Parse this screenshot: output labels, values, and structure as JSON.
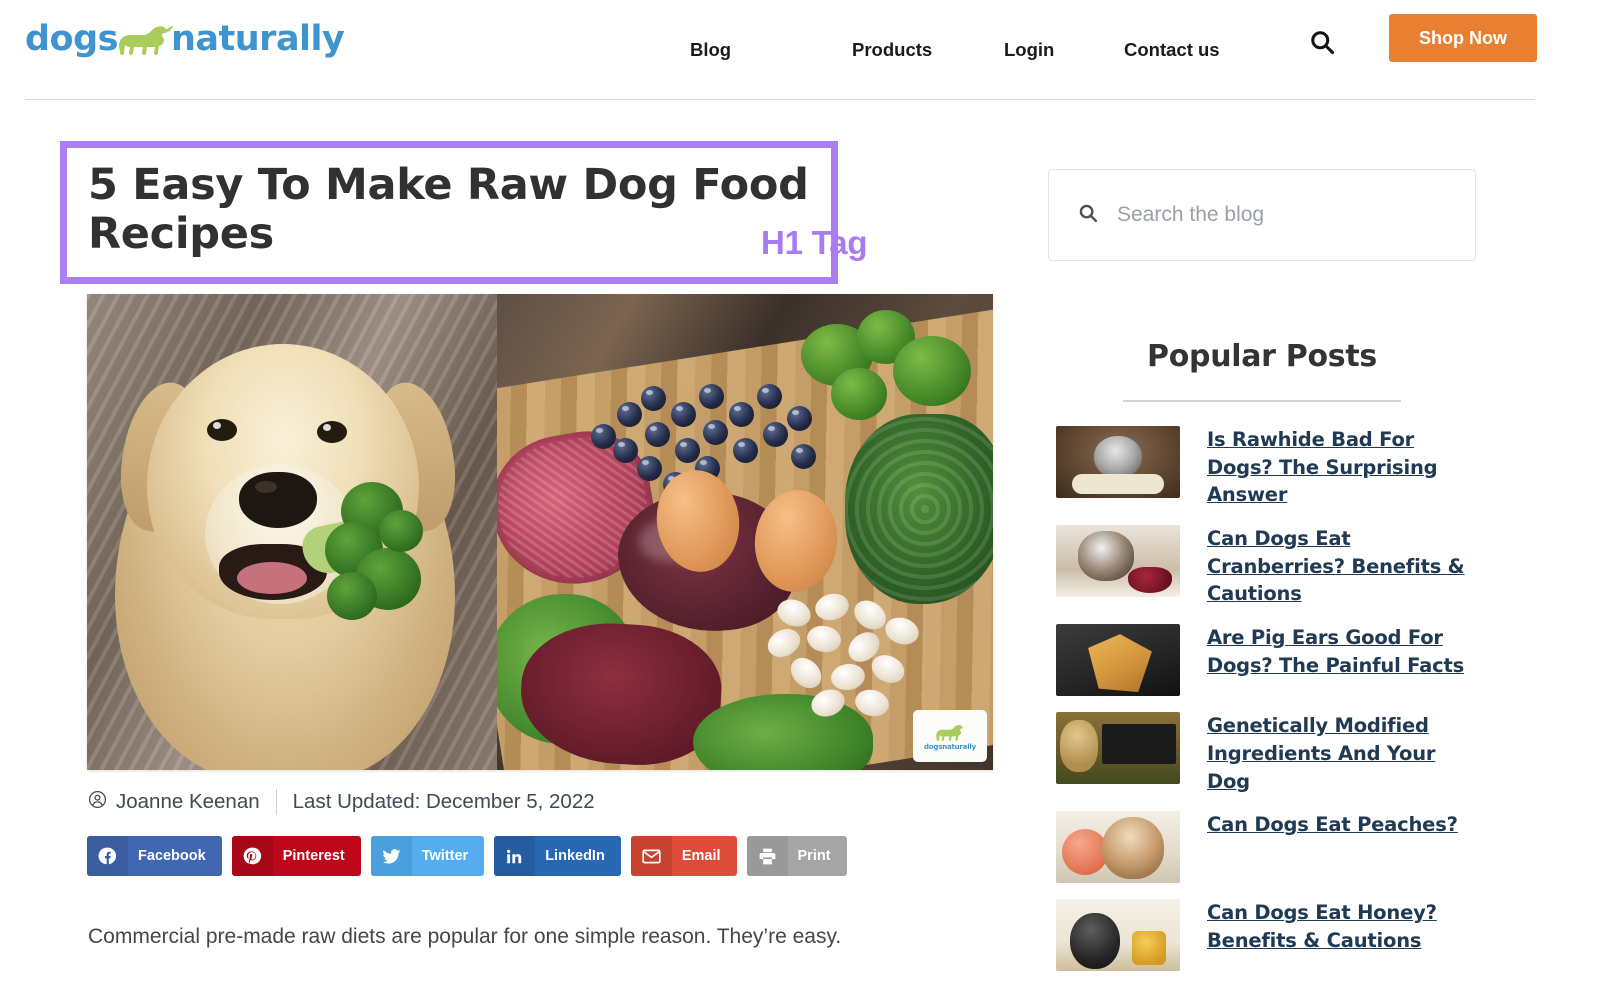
{
  "header": {
    "logo": {
      "text_before": "dogs",
      "text_after": "naturally",
      "icon": "dog-silhouette-icon"
    },
    "nav": [
      {
        "label": "Blog"
      },
      {
        "label": "Products"
      },
      {
        "label": "Login"
      },
      {
        "label": "Contact us"
      }
    ],
    "search_icon": "search-icon",
    "shop_now_label": "Shop Now",
    "accent_orange": "#e98031",
    "brand_blue": "#3f94cf",
    "brand_green": "#a9cc5a"
  },
  "article": {
    "title": "5 Easy To Make Raw Dog Food Recipes",
    "annotation_label": "H1 Tag",
    "annotation_color": "#ab7ff2",
    "author": "Joanne Keenan",
    "author_icon": "user-circle-icon",
    "updated": "Last Updated: December 5, 2022",
    "hero_alt": "Golden retriever holding broccoli beside raw dog food ingredients on a wooden board",
    "hero_watermark": "dogsnaturally",
    "paragraph": "Commercial pre-made raw diets are popular for one simple reason. They’re easy."
  },
  "share_buttons": [
    {
      "label": "Facebook",
      "icon": "facebook-icon",
      "color": "#4267b2"
    },
    {
      "label": "Pinterest",
      "icon": "pinterest-icon",
      "color": "#bd081c"
    },
    {
      "label": "Twitter",
      "icon": "twitter-icon",
      "color": "#55acee"
    },
    {
      "label": "LinkedIn",
      "icon": "linkedin-icon",
      "color": "#2867b2"
    },
    {
      "label": "Email",
      "icon": "envelope-icon",
      "color": "#dd4b39"
    },
    {
      "label": "Print",
      "icon": "printer-icon",
      "color": "#a5a5a5"
    }
  ],
  "sidebar": {
    "search": {
      "placeholder": "Search the blog",
      "value": "",
      "icon": "search-icon"
    },
    "popular_posts_title": "Popular Posts",
    "popular_posts": [
      {
        "title": "Is Rawhide Bad For Dogs? The Surprising Answer",
        "thumb": "dog-with-rawhide-bone-thumb"
      },
      {
        "title": "Can Dogs Eat Cranberries? Benefits & Cautions",
        "thumb": "dog-with-cranberries-thumb"
      },
      {
        "title": "Are Pig Ears Good For Dogs? The Painful Facts",
        "thumb": "pig-ears-chalkboard-thumb"
      },
      {
        "title": "Genetically Modified Ingredients And Your Dog",
        "thumb": "dog-in-corn-field-thumb"
      },
      {
        "title": "Can Dogs Eat Peaches?",
        "thumb": "corgi-with-peaches-thumb"
      },
      {
        "title": "Can Dogs Eat Honey? Benefits & Cautions",
        "thumb": "dog-with-honey-thumb"
      }
    ],
    "link_color": "#1f3a52"
  }
}
